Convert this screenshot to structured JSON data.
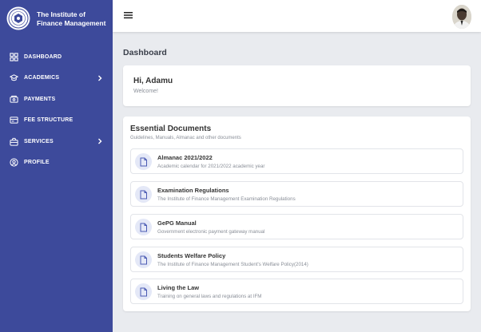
{
  "brand": {
    "name": "The Institute of Finance Management",
    "logo_icon": "ifm-seal-logo"
  },
  "sidebar": {
    "background": "#3d4a9b",
    "items": [
      {
        "label": "DASHBOARD",
        "icon": "dashboard-icon",
        "has_submenu": false
      },
      {
        "label": "ACADEMICS",
        "icon": "graduation-cap-icon",
        "has_submenu": true
      },
      {
        "label": "PAYMENTS",
        "icon": "payments-icon",
        "has_submenu": false
      },
      {
        "label": "FEE STRUCTURE",
        "icon": "fee-structure-icon",
        "has_submenu": false
      },
      {
        "label": "SERVICES",
        "icon": "services-icon",
        "has_submenu": true
      },
      {
        "label": "PROFILE",
        "icon": "profile-icon",
        "has_submenu": false
      }
    ]
  },
  "topbar": {
    "menu_icon": "hamburger-icon",
    "avatar": "user-avatar"
  },
  "page": {
    "title": "Dashboard"
  },
  "welcome": {
    "greeting": "Hi, Adamu",
    "message": "Welcome!"
  },
  "documents": {
    "title": "Essential Documents",
    "subtitle": "Guidelines, Manuals, Almanac and other documents",
    "items": [
      {
        "title": "Almanac 2021/2022",
        "description": "Academic calendar for 2021/2022 academic year"
      },
      {
        "title": "Examination Regulations",
        "description": "The Institute of Finance Management Examination Regulations"
      },
      {
        "title": "GePG Manual",
        "description": "Government electronic payment gateway manual"
      },
      {
        "title": "Students Welfare Policy",
        "description": "The Institute of Finance Management Student's Welfare Policy(2014)"
      },
      {
        "title": "Living the Law",
        "description": "Training on general laws and regulations at IFM"
      }
    ]
  }
}
